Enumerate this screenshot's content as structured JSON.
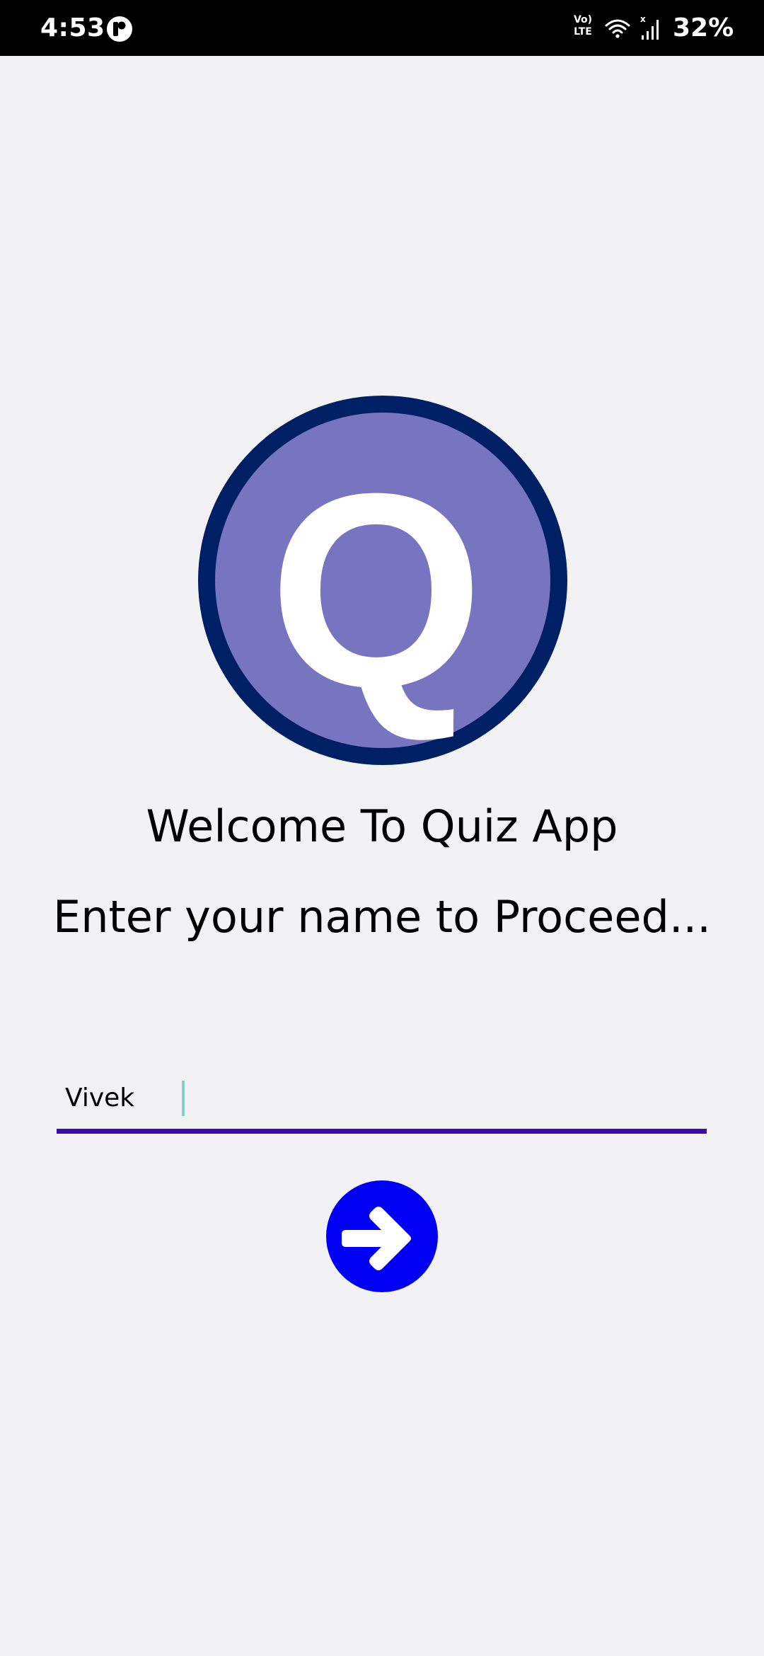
{
  "status_bar": {
    "time": "4:53",
    "volte_top": "Vo)",
    "volte_bottom": "LTE",
    "battery": "32%",
    "icons": [
      "app-notification-icon",
      "volte-icon",
      "wifi-icon",
      "signal-icon"
    ]
  },
  "main": {
    "logo_letter": "Q",
    "title": "Welcome To Quiz App",
    "prompt": "Enter your name to Proceed...",
    "name_input_value": "Vivek",
    "next_button_icon": "arrow-right-icon"
  },
  "colors": {
    "background": "#F2F2F4",
    "logo_ring": "#002066",
    "logo_fill": "#7774C0",
    "accent_underline": "#3A0CB0",
    "button": "#0000F5",
    "caret": "#7FCFC4"
  }
}
